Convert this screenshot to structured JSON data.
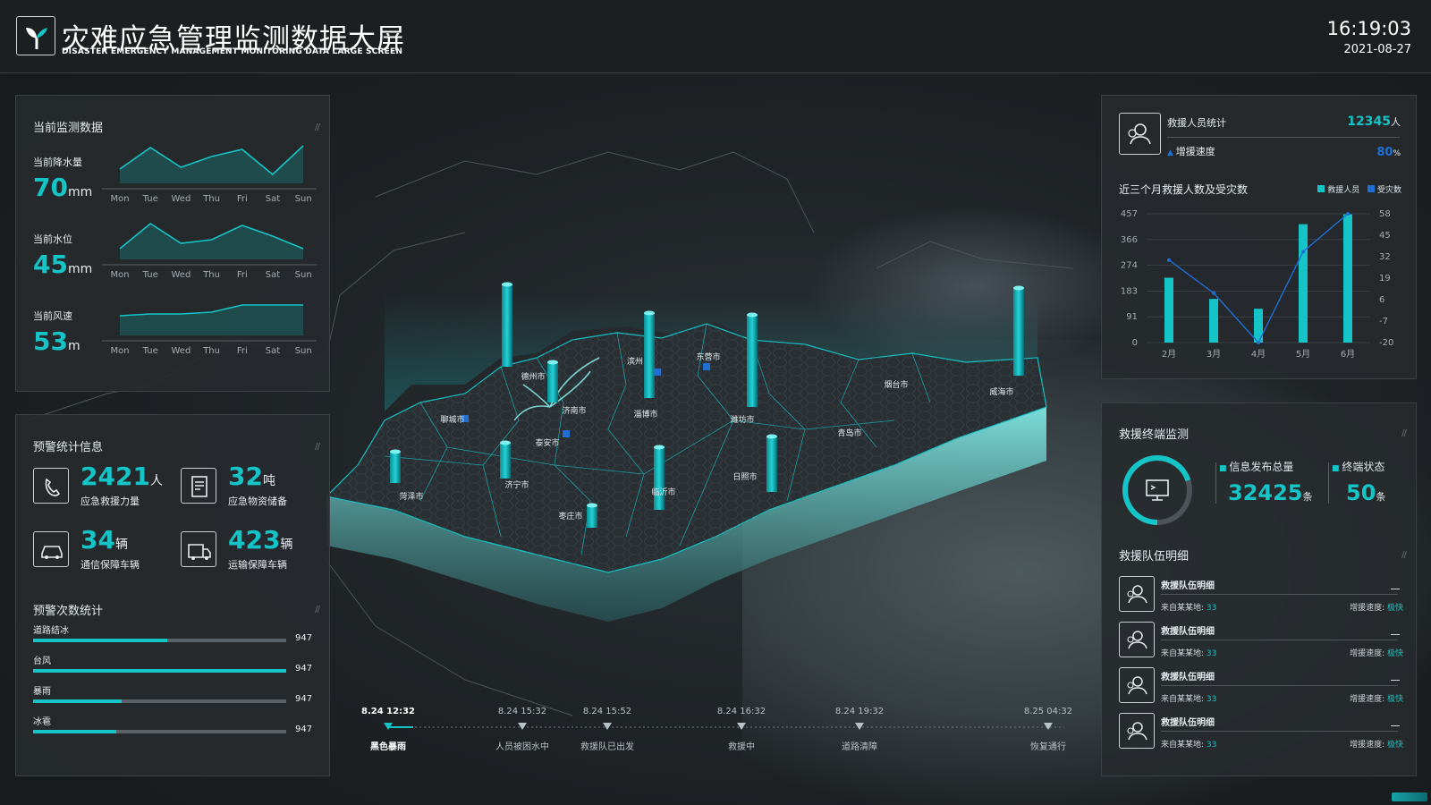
{
  "header": {
    "title": "灾难应急管理监测数据大屏",
    "subtitle": "DISASTER EMERGENCY MANAGEMENT MONITORING DATA LARGE SCREEN",
    "time": "16:19:03",
    "date": "2021-08-27"
  },
  "monitor": {
    "title": "当前监测数据",
    "days": [
      "Mon",
      "Tue",
      "Wed",
      "Thu",
      "Fri",
      "Sat",
      "Sun"
    ],
    "items": [
      {
        "label": "当前降水量",
        "value": "70",
        "unit": "mm"
      },
      {
        "label": "当前水位",
        "value": "45",
        "unit": "mm"
      },
      {
        "label": "当前风速",
        "value": "53",
        "unit": "m"
      }
    ]
  },
  "warning_stats": {
    "title": "预警统计信息",
    "items": [
      {
        "value": "2421",
        "unit": "人",
        "label": "应急救援力量",
        "icon": "phone-icon"
      },
      {
        "value": "32",
        "unit": "吨",
        "label": "应急物资储备",
        "icon": "document-icon"
      },
      {
        "value": "34",
        "unit": "辆",
        "label": "通信保障车辆",
        "icon": "car-icon"
      },
      {
        "value": "423",
        "unit": "辆",
        "label": "运输保障车辆",
        "icon": "truck-icon"
      }
    ]
  },
  "warning_counts": {
    "title": "预警次数统计",
    "items": [
      {
        "label": "道路结冰",
        "value": "947",
        "fill": 0.53
      },
      {
        "label": "台风",
        "value": "947",
        "fill": 1.0
      },
      {
        "label": "暴雨",
        "value": "947",
        "fill": 0.35
      },
      {
        "label": "冰雹",
        "value": "947",
        "fill": 0.33
      }
    ]
  },
  "map": {
    "cities": [
      "德州市",
      "聊城市",
      "济南市",
      "泰安市",
      "滨州",
      "东营市",
      "淄博市",
      "潍坊市",
      "烟台市",
      "威海市",
      "青岛市",
      "日照市",
      "临沂市",
      "枣庄市",
      "济宁市",
      "菏泽市"
    ],
    "timeline": [
      {
        "time": "8.24 12:32",
        "label": "黑色暴雨",
        "active": true
      },
      {
        "time": "8.24 15:32",
        "label": "人员被困水中",
        "active": false
      },
      {
        "time": "8.24 15:52",
        "label": "救援队已出发",
        "active": false
      },
      {
        "time": "8.24 16:32",
        "label": "救援中",
        "active": false
      },
      {
        "time": "8.24 19:32",
        "label": "道路清障",
        "active": false
      },
      {
        "time": "8.25 04:32",
        "label": "恢复通行",
        "active": false
      }
    ]
  },
  "rescue": {
    "stat_label": "救援人员统计",
    "stat_value": "12345",
    "stat_unit": "人",
    "speed_label": "增援速度",
    "speed_value": "80",
    "speed_unit": "%",
    "chart_title": "近三个月救援人数及受灾数",
    "legend_rescue": "救援人员",
    "legend_disaster": "受灾数"
  },
  "chart_data": {
    "type": "bar",
    "title": "近三个月救援人数及受灾数",
    "categories": [
      "2月",
      "3月",
      "4月",
      "5月",
      "6月"
    ],
    "left_ticks": [
      "457",
      "366",
      "274",
      "183",
      "91",
      "0"
    ],
    "right_ticks": [
      "58",
      "45",
      "32",
      "19",
      "6",
      "-7",
      "-20"
    ],
    "ylim_left": [
      0,
      457
    ],
    "ylim_right": [
      -20,
      58
    ],
    "series": [
      {
        "name": "救援人员",
        "type": "bar",
        "axis": "left",
        "color": "#14c4c6",
        "values": [
          230,
          155,
          120,
          420,
          455
        ]
      },
      {
        "name": "受灾数",
        "type": "line",
        "axis": "right",
        "color": "#1f6fd6",
        "values": [
          30,
          10,
          -20,
          35,
          58
        ]
      }
    ]
  },
  "terminal": {
    "title": "救援终端监测",
    "info_label": "信息发布总量",
    "info_value": "32425",
    "info_unit": "条",
    "status_label": "终端状态",
    "status_value": "50",
    "status_unit": "条",
    "ring_fill": 0.7
  },
  "teams": {
    "title": "救援队伍明细",
    "items": [
      {
        "name": "救援队伍明细",
        "from_label": "来自某某地:",
        "from_value": "33",
        "speed_label": "增援速度:",
        "speed_value": "极快"
      },
      {
        "name": "救援队伍明细",
        "from_label": "来自某某地:",
        "from_value": "33",
        "speed_label": "增援速度:",
        "speed_value": "极快"
      },
      {
        "name": "救援队伍明细",
        "from_label": "来自某某地:",
        "from_value": "33",
        "speed_label": "增援速度:",
        "speed_value": "极快"
      },
      {
        "name": "救援队伍明细",
        "from_label": "来自某某地:",
        "from_value": "33",
        "speed_label": "增援速度:",
        "speed_value": "极快"
      }
    ]
  },
  "colors": {
    "accent": "#14c4c6",
    "secondary": "#1f6fd6",
    "background": "#1b1e21"
  }
}
